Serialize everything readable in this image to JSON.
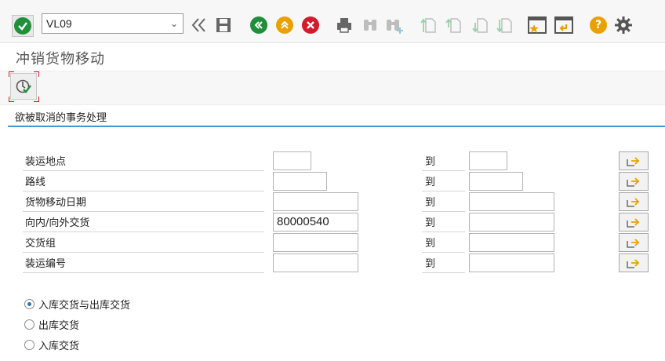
{
  "toolbar": {
    "command_value": "VL09",
    "icons": [
      "check-icon",
      "back-double-icon",
      "save-icon",
      "back-icon",
      "exit-icon",
      "cancel-icon",
      "print-icon",
      "find-icon",
      "find-next-icon",
      "first-page-icon",
      "previous-page-icon",
      "next-page-icon",
      "last-page-icon",
      "create-session-icon",
      "shortcut-icon",
      "help-icon",
      "settings-icon"
    ],
    "colors": {
      "green": "#1f8f3a",
      "orange": "#e9a100",
      "red": "#d51b2b",
      "blue_rule": "#3c9ad6"
    }
  },
  "page": {
    "title": "冲销货物移动",
    "execute_icon": "execute-icon"
  },
  "group": {
    "title": "欲被取消的事务处理"
  },
  "form": {
    "rows": [
      {
        "label": "装运地点",
        "from": "",
        "to_label": "到",
        "to": ""
      },
      {
        "label": "路线",
        "from": "",
        "to_label": "到",
        "to": ""
      },
      {
        "label": "货物移动日期",
        "from": "",
        "to_label": "到",
        "to": ""
      },
      {
        "label": "向内/向外交货",
        "from": "80000540",
        "to_label": "到",
        "to": ""
      },
      {
        "label": "交货组",
        "from": "",
        "to_label": "到",
        "to": ""
      },
      {
        "label": "装运编号",
        "from": "",
        "to_label": "到",
        "to": ""
      }
    ]
  },
  "options": {
    "radios": [
      {
        "label": "入库交货与出库交货",
        "selected": true
      },
      {
        "label": "出库交货",
        "selected": false
      },
      {
        "label": "入库交货",
        "selected": false
      }
    ]
  }
}
